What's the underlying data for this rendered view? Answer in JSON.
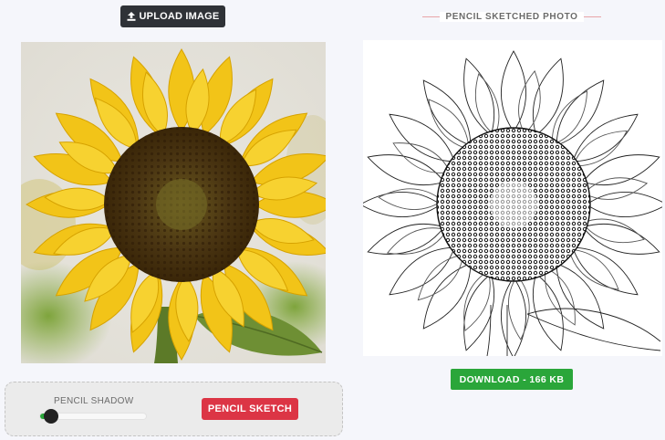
{
  "upload": {
    "label": "UPLOAD IMAGE",
    "icon": "upload-icon"
  },
  "output": {
    "heading": "PENCIL SKETCHED PHOTO"
  },
  "download": {
    "label": "DOWNLOAD - 166 KB"
  },
  "controls": {
    "shadow_label": "PENCIL SHADOW",
    "shadow_level": 0.08,
    "sketch_label": "PENCIL SKETCH"
  },
  "colors": {
    "accent_green": "#2aa63a",
    "accent_red": "#dc3545",
    "dark": "#2f3237"
  }
}
